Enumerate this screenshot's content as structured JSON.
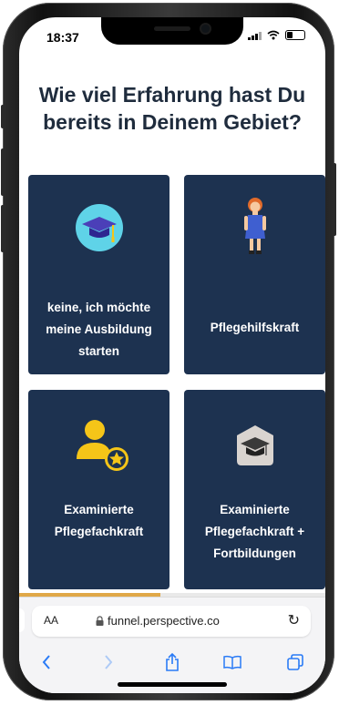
{
  "status_bar": {
    "time": "18:37"
  },
  "question": {
    "title": "Wie viel Erfahrung hast Du bereits in Deinem Gebiet?"
  },
  "options": [
    {
      "label": "keine, ich möchte meine Ausbildung starten",
      "icon": "graduation-cap-icon"
    },
    {
      "label": "Pflegehilfskraft",
      "icon": "nurse-figure-icon"
    },
    {
      "label": "Examinierte Pflegefachkraft",
      "icon": "person-star-icon"
    },
    {
      "label": "Examinierte Pflegefachkraft + Fortbildungen",
      "icon": "graduation-hat-badge-icon"
    }
  ],
  "progress": {
    "value": 0.46
  },
  "browser": {
    "aa_label": "AA",
    "url": "funnel.perspective.co"
  },
  "colors": {
    "card": "#1d3250",
    "progress": "#e0a848",
    "accent_yellow": "#f5c518",
    "browser_blue": "#2a7bf6"
  }
}
